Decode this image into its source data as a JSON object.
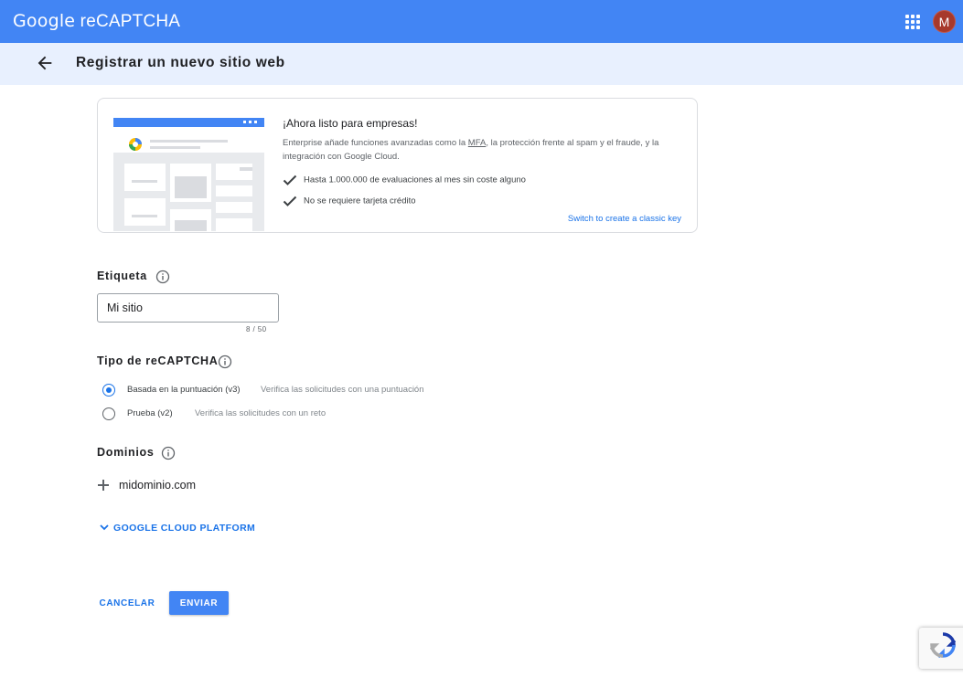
{
  "header": {
    "logo_google": "Google",
    "logo_product": " reCAPTCHA",
    "avatar_letter": "M",
    "brand_color": "#4285f4"
  },
  "subheader": {
    "title": "Registrar un nuevo sitio web",
    "background": "#e8f0fe"
  },
  "promo": {
    "title": "¡Ahora listo para empresas!",
    "desc_before": "Enterprise añade funciones avanzadas como la ",
    "desc_link": "MFA",
    "desc_after": ", la protección frente al spam y el fraude, y la integración con Google Cloud.",
    "bullets": [
      "Hasta 1.000.000 de evaluaciones al mes sin coste alguno",
      "No se requiere tarjeta crédito"
    ],
    "switch_link": "Switch to create a classic key"
  },
  "label_section": {
    "heading": "Etiqueta",
    "value": "Mi sitio",
    "counter": "8 / 50"
  },
  "type_section": {
    "heading": "Tipo de reCAPTCHA",
    "options": [
      {
        "label": "Basada en la puntuación (v3)",
        "desc": "Verifica las solicitudes con una puntuación",
        "checked": true
      },
      {
        "label": "Prueba (v2)",
        "desc": "Verifica las solicitudes con un reto",
        "checked": false
      }
    ]
  },
  "domains_section": {
    "heading": "Dominios",
    "placeholder": "midominio.com"
  },
  "gcp": {
    "label": "GOOGLE CLOUD PLATFORM"
  },
  "actions": {
    "cancel": "CANCELAR",
    "submit": "ENVIAR"
  },
  "icons": {
    "apps": "apps-grid-icon",
    "back": "arrow-back-icon",
    "info": "info-icon",
    "check": "check-icon",
    "add": "plus-icon",
    "expand": "chevron-down-icon",
    "recaptcha": "recaptcha-logo-icon"
  }
}
